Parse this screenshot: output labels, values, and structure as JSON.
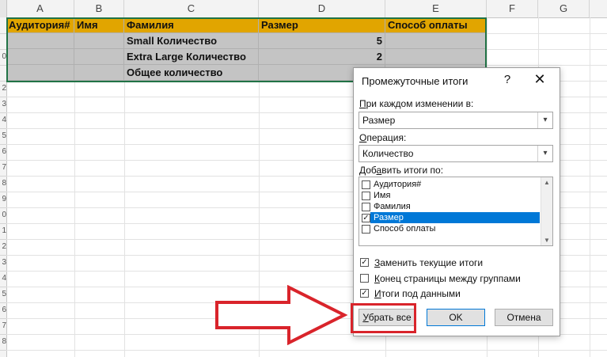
{
  "columns": [
    "A",
    "B",
    "C",
    "D",
    "E",
    "F",
    "G"
  ],
  "rows": [
    "",
    "",
    "0",
    "",
    "2",
    "3",
    "4",
    "5",
    "6",
    "7",
    "8",
    "9",
    "0",
    "1",
    "2",
    "3",
    "4",
    "5",
    "6",
    "7",
    "8"
  ],
  "table": {
    "headers": [
      "Аудитория#",
      "Имя",
      "Фамилия",
      "Размер",
      "Способ оплаты"
    ],
    "rows": [
      [
        "",
        "",
        "Small Количество",
        "5",
        ""
      ],
      [
        "",
        "",
        "Extra Large Количество",
        "2",
        ""
      ],
      [
        "",
        "",
        "Общее количество",
        "",
        ""
      ]
    ],
    "header_color": "#e1a500",
    "data_color": "#c4c4c4"
  },
  "dialog": {
    "title": "Промежуточные итоги",
    "help": "?",
    "close": "✕",
    "group_by_label": "При каждом изменении в:",
    "group_by_accel": "П",
    "group_by_rest": "ри каждом изменении в:",
    "group_by_value": "Размер",
    "function_accel": "О",
    "function_rest": "перация:",
    "function_value": "Количество",
    "add_to_pre": "Доб",
    "add_to_accel": "а",
    "add_to_rest": "вить итоги по:",
    "fields": [
      {
        "label": "Аудитория#",
        "checked": false,
        "selected": false
      },
      {
        "label": "Имя",
        "checked": false,
        "selected": false
      },
      {
        "label": "Фамилия",
        "checked": false,
        "selected": false
      },
      {
        "label": "Размер",
        "checked": true,
        "selected": true
      },
      {
        "label": "Способ оплаты",
        "checked": false,
        "selected": false
      }
    ],
    "options": [
      {
        "pre": "",
        "accel": "З",
        "rest": "аменить текущие итоги",
        "checked": true
      },
      {
        "pre": "",
        "accel": "К",
        "rest": "онец страницы между группами",
        "checked": false
      },
      {
        "pre": "",
        "accel": "И",
        "rest": "тоги под данными",
        "checked": true
      }
    ],
    "remove_all_accel": "У",
    "remove_all_rest": "брать все",
    "ok_label": "OK",
    "cancel_label": "Отмена",
    "check_mark": "✓",
    "dropdown_glyph": "▾",
    "scroll_up_glyph": "▲",
    "scroll_down_glyph": "▼"
  },
  "annotation": {
    "color": "#d9242b"
  }
}
